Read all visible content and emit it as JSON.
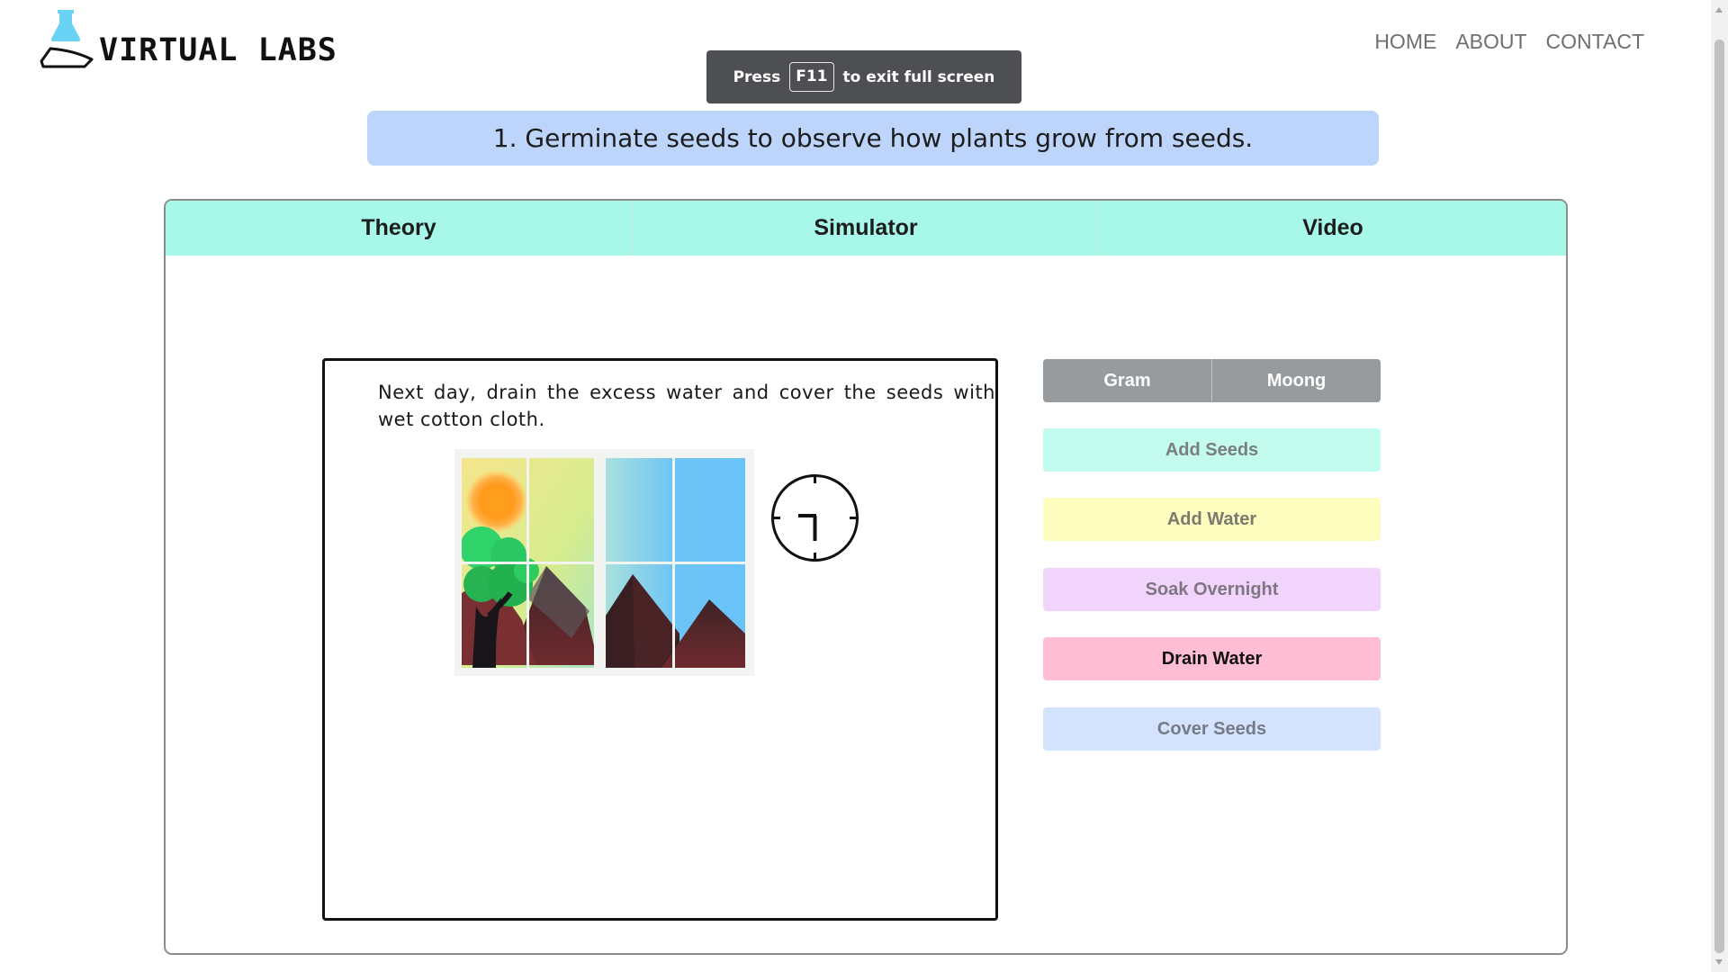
{
  "brand": {
    "name": "VIRTUAL LABS"
  },
  "nav": {
    "items": [
      "HOME",
      "ABOUT",
      "CONTACT"
    ]
  },
  "fullscreen_hint": {
    "prefix": "Press",
    "key": "F11",
    "suffix": "to exit full screen"
  },
  "experiment": {
    "title": "1. Germinate seeds to observe how plants grow from seeds."
  },
  "tabs": [
    {
      "label": "Theory"
    },
    {
      "label": "Simulator"
    },
    {
      "label": "Video"
    }
  ],
  "simulator": {
    "instruction": "Next day, drain the excess water and cover the seeds with wet cotton cloth.",
    "seed_options": [
      "Gram",
      "Moong"
    ],
    "actions": [
      {
        "label": "Add Seeds",
        "bg": "#c3fbef",
        "fg": "#7a7f7e"
      },
      {
        "label": "Add Water",
        "bg": "#fdfdc0",
        "fg": "#7a7a6e"
      },
      {
        "label": "Soak Overnight",
        "bg": "#f1d4fb",
        "fg": "#7f7682"
      },
      {
        "label": "Drain Water",
        "bg": "#ffbed3",
        "fg": "#121212"
      },
      {
        "label": "Cover Seeds",
        "bg": "#d4e3fd",
        "fg": "#757b86"
      }
    ]
  },
  "colors": {
    "title_bg": "#bdd5fb",
    "tabs_bg": "#a7f8e8",
    "toggle_bg": "#989b9e"
  },
  "icons": {
    "logo": "flask-icon",
    "clock": "clock-icon"
  }
}
